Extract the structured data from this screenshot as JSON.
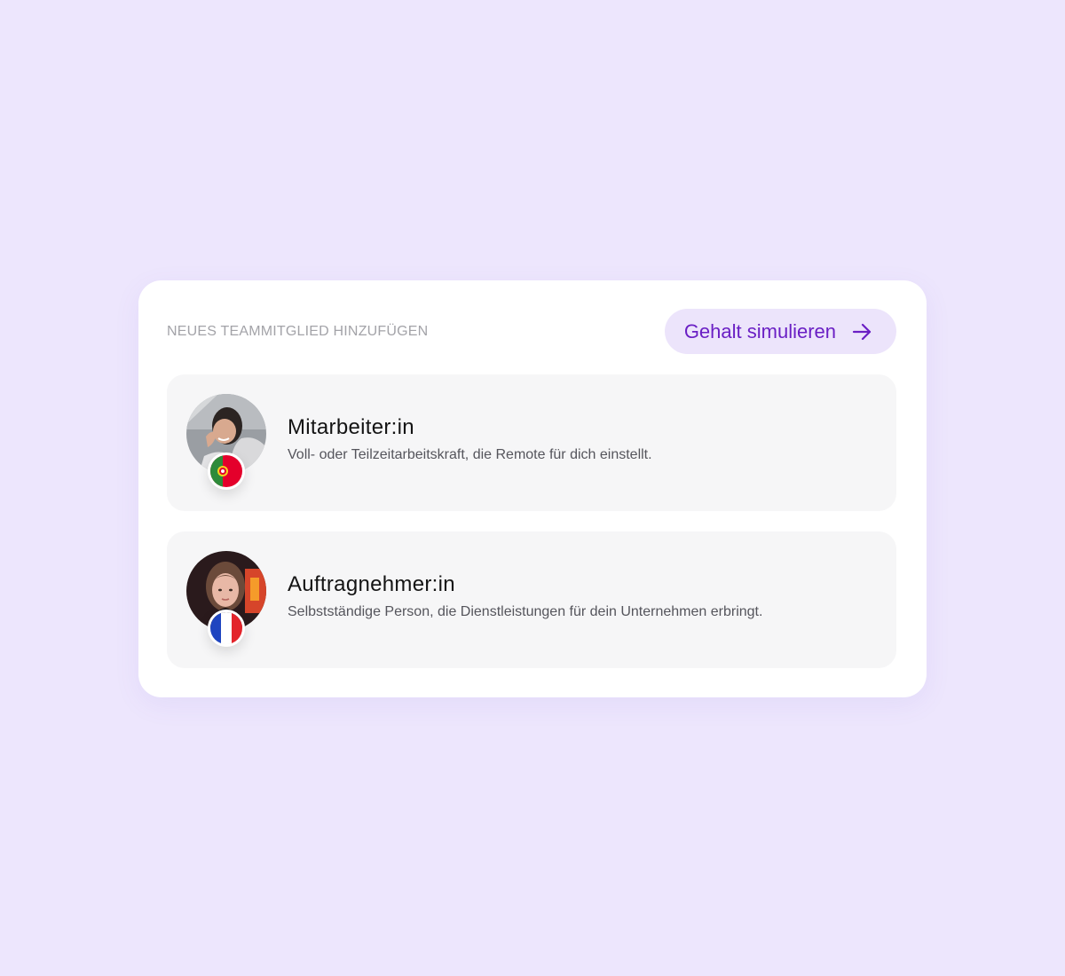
{
  "header": {
    "section_title": "NEUES TEAMMITGLIED HINZUFÜGEN",
    "cta_label": "Gehalt simulieren",
    "cta_icon": "arrow-right-icon"
  },
  "options": [
    {
      "title": "Mitarbeiter:in",
      "description": "Voll- oder Teilzeitarbeitskraft, die Remote für dich einstellt.",
      "flag": "portugal-flag-icon"
    },
    {
      "title": "Auftragnehmer:in",
      "description": "Selbstständige Person, die Dienstleistungen für dein Unternehmen erbringt.",
      "flag": "france-flag-icon"
    }
  ],
  "colors": {
    "background": "#ede6fd",
    "accent": "#6a1fc4",
    "cta_bg": "#ece4fb",
    "option_bg": "#f6f6f7"
  }
}
